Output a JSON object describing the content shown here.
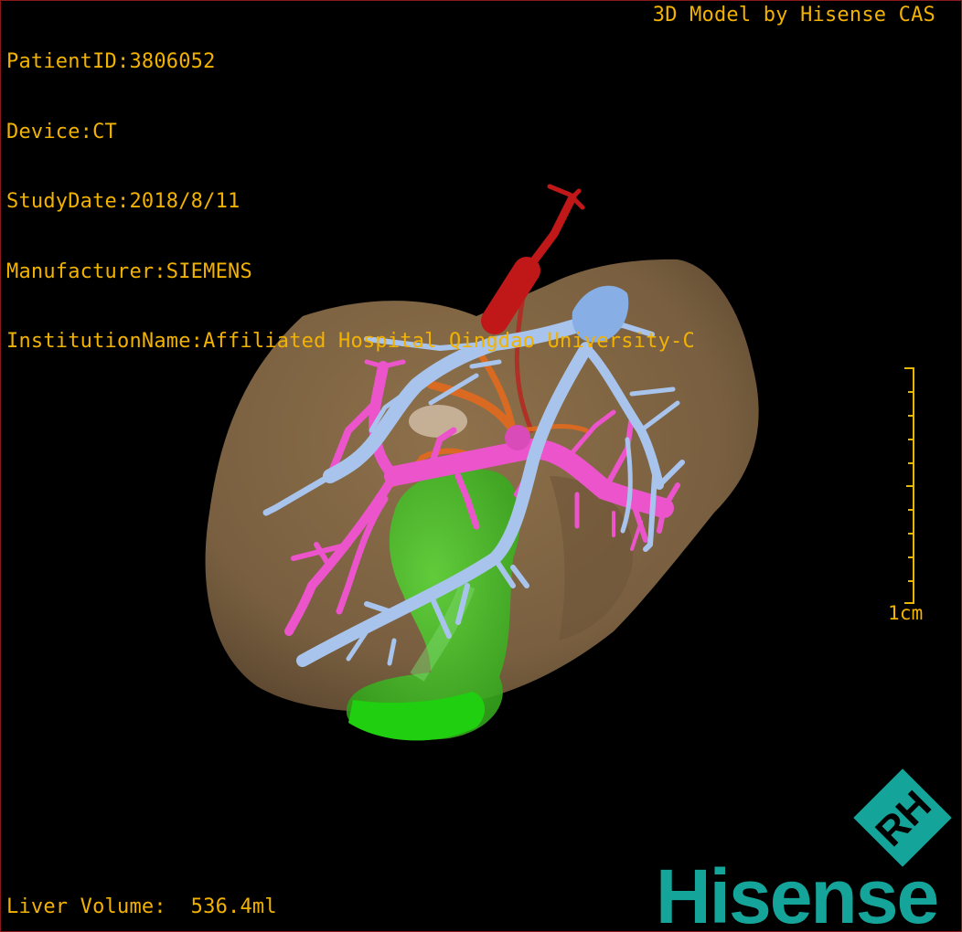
{
  "overlay": {
    "patient_id": "PatientID:3806052",
    "device": "Device:CT",
    "study_date": "StudyDate:2018/8/11",
    "manufacturer": "Manufacturer:SIEMENS",
    "institution": "InstitutionName:Affiliated Hospital Qingdao University-C",
    "credit": "3D Model by Hisense CAS",
    "liver_volume": "Liver Volume:  536.4ml"
  },
  "scale": {
    "label": "1cm"
  },
  "brand": {
    "wordmark": "Hisense",
    "badge_letters": "RH"
  },
  "colors": {
    "overlay_text": "#f2b200",
    "liver": "#8b6d4a",
    "hepatic_vein": "#a8c4ec",
    "portal_vein": "#ec54cc",
    "artery": "#c01818",
    "biliary": "#e86a1c",
    "gallbladder": "#3fc21f",
    "brand": "#15a49a",
    "frame": "#8a1a1a"
  },
  "icons": [
    "hisense-rh-badge-icon"
  ]
}
